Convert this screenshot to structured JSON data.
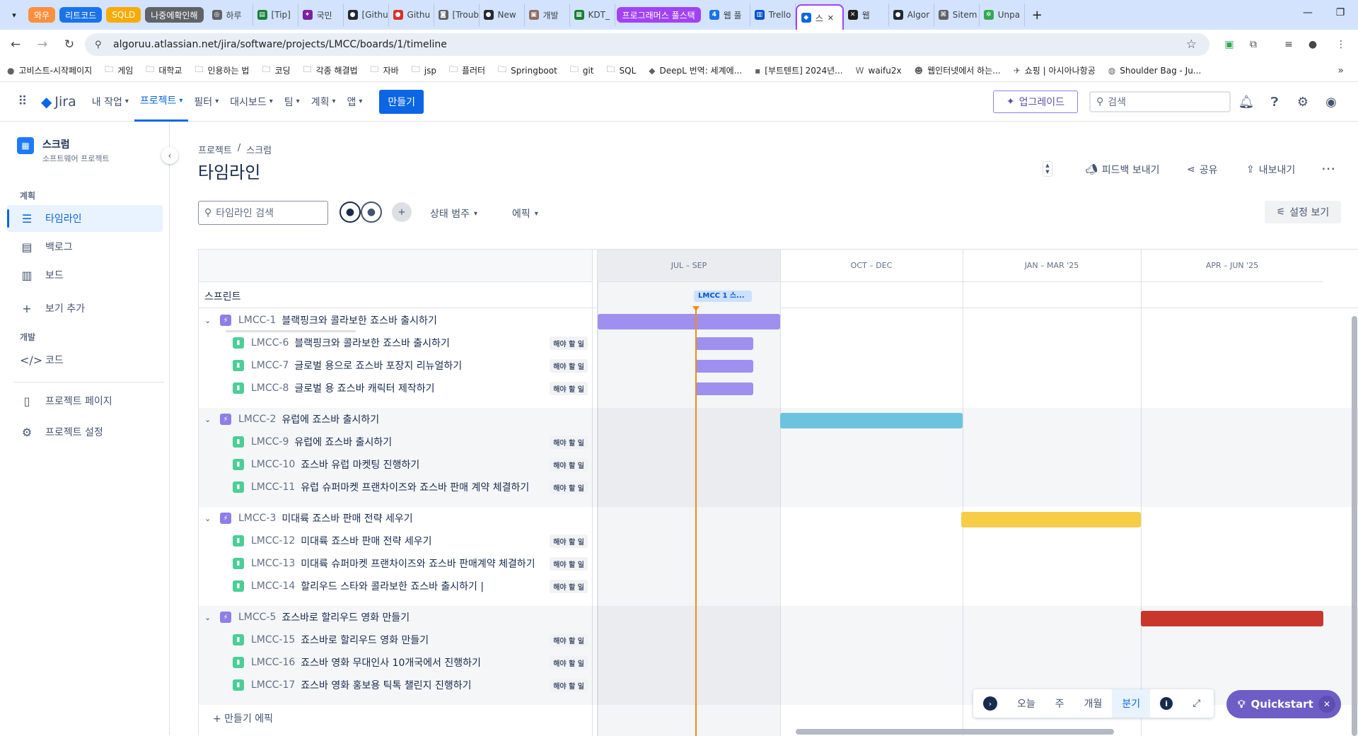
{
  "browser": {
    "tab_groups": [
      {
        "label": "와우",
        "color": "#fa903e"
      },
      {
        "label": "리트코드",
        "color": "#1a73e8"
      },
      {
        "label": "SQLD",
        "color": "#f9ab00"
      },
      {
        "label": "나중에확인해",
        "color": "#5f6368"
      },
      {
        "label": "프로그래머스 풀스택",
        "color": "#a142f4"
      }
    ],
    "tabs": [
      {
        "label": "하루",
        "icon": "globe-icon",
        "color": "#5f6368"
      },
      {
        "label": "[Tip]",
        "icon": "doc-icon",
        "color": "#188038"
      },
      {
        "label": "국민",
        "icon": "puzzle-icon",
        "color": "#7b1fa2"
      },
      {
        "label": "[Githu",
        "icon": "github-icon",
        "color": "#24292f"
      },
      {
        "label": "Githu",
        "icon": "github-icon",
        "color": "#d93025"
      },
      {
        "label": "[Troub",
        "icon": "robot-icon",
        "color": "#5f6368"
      },
      {
        "label": "New",
        "icon": "github-icon",
        "color": "#24292f"
      },
      {
        "label": "개발",
        "icon": "image-icon",
        "color": "#8d6e63"
      },
      {
        "label": "KDT_",
        "icon": "sheet-icon",
        "color": "#188038"
      },
      {
        "label": "웹 풀",
        "icon": "num-icon",
        "color": "#1a73e8"
      },
      {
        "label": "Trello",
        "icon": "trello-icon",
        "color": "#0052cc"
      },
      {
        "label": "스",
        "icon": "jira-icon",
        "color": "#0c66e4",
        "active": true
      },
      {
        "label": "웹",
        "icon": "bird-icon",
        "color": "#1f1f1f"
      },
      {
        "label": "Algor",
        "icon": "github-icon",
        "color": "#24292f"
      },
      {
        "label": "Sitem",
        "icon": "map-icon",
        "color": "#5f6368"
      },
      {
        "label": "Unpa",
        "icon": "gear-icon",
        "color": "#34a853"
      }
    ],
    "url": "algoruu.atlassian.net/jira/software/projects/LMCC/boards/1/timeline",
    "bookmarks": [
      {
        "label": "고비스트-시작페이지",
        "icon": "orange-icon"
      },
      {
        "label": "게임",
        "icon": "folder-icon"
      },
      {
        "label": "대학교",
        "icon": "folder-icon"
      },
      {
        "label": "인용하는 법",
        "icon": "folder-icon"
      },
      {
        "label": "코딩",
        "icon": "folder-icon"
      },
      {
        "label": "각종 해결법",
        "icon": "folder-icon"
      },
      {
        "label": "자바",
        "icon": "folder-icon"
      },
      {
        "label": "jsp",
        "icon": "folder-icon"
      },
      {
        "label": "플러터",
        "icon": "folder-icon"
      },
      {
        "label": "Springboot",
        "icon": "folder-icon"
      },
      {
        "label": "git",
        "icon": "folder-icon"
      },
      {
        "label": "SQL",
        "icon": "folder-icon"
      },
      {
        "label": "DeepL 번역: 세계에...",
        "icon": "deepl-icon"
      },
      {
        "label": "[부트텐트] 2024년...",
        "icon": "bt-icon"
      },
      {
        "label": "waifu2x",
        "icon": "w-icon"
      },
      {
        "label": "웹인터넷에서 하는...",
        "icon": "smile-icon"
      },
      {
        "label": "쇼핑 | 아시아나항공",
        "icon": "plane-icon"
      },
      {
        "label": "Shoulder Bag - Ju...",
        "icon": "bag-icon"
      }
    ]
  },
  "jira": {
    "logo": "Jira",
    "nav": [
      {
        "label": "내 작업",
        "active": false
      },
      {
        "label": "프로젝트",
        "active": true
      },
      {
        "label": "필터",
        "active": false
      },
      {
        "label": "대시보드",
        "active": false
      },
      {
        "label": "팀",
        "active": false
      },
      {
        "label": "계획",
        "active": false
      },
      {
        "label": "앱",
        "active": false
      }
    ],
    "create_label": "만들기",
    "upgrade_label": "업그레이드",
    "search_placeholder": "검색"
  },
  "sidebar": {
    "project_name": "스크럼",
    "project_type": "소프트웨어 프로젝트",
    "section_plan": "계획",
    "section_dev": "개발",
    "items": {
      "timeline": "타임라인",
      "backlog": "백로그",
      "board": "보드",
      "add_view": "보기 추가",
      "code": "코드",
      "project_page": "프로젝트 페이지",
      "project_settings": "프로젝트 설정"
    }
  },
  "main": {
    "breadcrumb": [
      "프로젝트",
      "스크럼"
    ],
    "title": "타임라인",
    "feedback": "피드백 보내기",
    "share": "공유",
    "export": "내보내기",
    "search_placeholder": "타임라인 검색",
    "filter_status": "상태 범주",
    "filter_epic": "에픽",
    "view_settings": "설정 보기",
    "sprint_label": "스프린트",
    "sprint_chip": "LMCC 1 스...",
    "create_epic": "+ 만들기 에픽",
    "quarters": [
      "JUL – SEP",
      "OCT – DEC",
      "JAN – MAR '25",
      "APR – JUN '25"
    ],
    "todo_label": "해야 할 일",
    "epics": [
      {
        "key": "LMCC-1",
        "title": "블랙핑크와 콜라보한 죠스바 출시하기",
        "color": "#9f8fef",
        "children": [
          {
            "key": "LMCC-6",
            "title": "블랙핑크와 콜라보한 죠스바 출시하기"
          },
          {
            "key": "LMCC-7",
            "title": "글로벌 용으로 죠스바 포장지 리뉴얼하기"
          },
          {
            "key": "LMCC-8",
            "title": "글로벌 용 죠스바 캐릭터 제작하기"
          }
        ]
      },
      {
        "key": "LMCC-2",
        "title": "유럽에 죠스바 출시하기",
        "color": "#6cc3e0",
        "children": [
          {
            "key": "LMCC-9",
            "title": "유럽에 죠스바 출시하기"
          },
          {
            "key": "LMCC-10",
            "title": "죠스바 유럽 마켓팅 진행하기"
          },
          {
            "key": "LMCC-11",
            "title": "유럽 슈퍼마켓 프랜차이즈와 죠스바 판매 계약 체결하기"
          }
        ]
      },
      {
        "key": "LMCC-3",
        "title": "미대륙 죠스바 판매 전략 세우기",
        "color": "#f5cd47",
        "children": [
          {
            "key": "LMCC-12",
            "title": "미대륙 죠스바 판매 전략 세우기"
          },
          {
            "key": "LMCC-13",
            "title": "미대륙 슈퍼마켓 프랜차이즈와 죠스바 판매계약 체결하기"
          },
          {
            "key": "LMCC-14",
            "title": "할리우드 스타와 콜라보한 죠스바 출시하기 |"
          }
        ]
      },
      {
        "key": "LMCC-5",
        "title": "죠스바로 할리우드 영화 만들기",
        "color": "#c9372c",
        "children": [
          {
            "key": "LMCC-15",
            "title": "죠스바로 할리우드 영화 만들기"
          },
          {
            "key": "LMCC-16",
            "title": "죠스바 영화 무대인사 10개국에서 진행하기"
          },
          {
            "key": "LMCC-17",
            "title": "죠스바 영화 홍보용 틱톡 챌린지 진행하기"
          }
        ]
      }
    ],
    "bottom_tools": {
      "today": "오늘",
      "week": "주",
      "month": "개월",
      "quarter": "분기"
    },
    "quickstart": "Quickstart"
  }
}
